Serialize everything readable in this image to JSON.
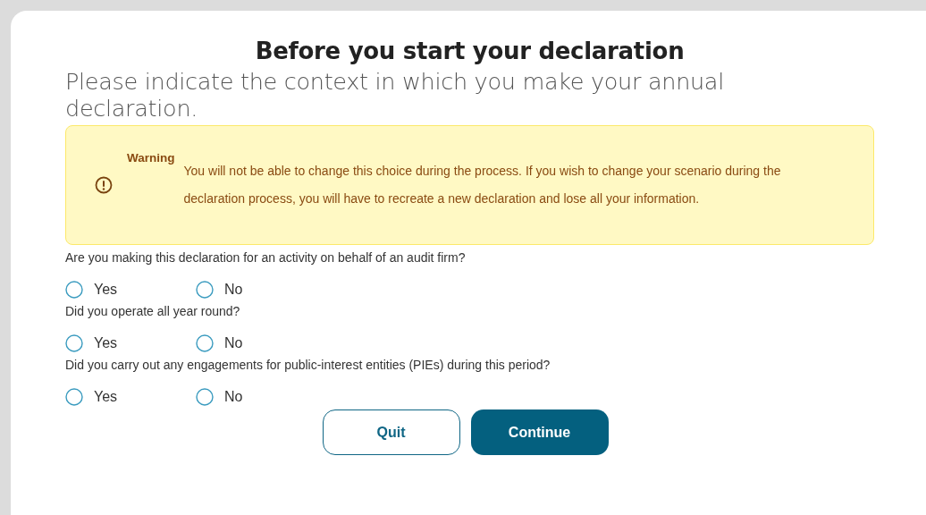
{
  "dialog": {
    "title": "Before you start your declaration",
    "subtitle": "Please indicate the context in which you make your annual declaration."
  },
  "warning": {
    "label": "Warning",
    "message": "You will not be able to change this choice during the process. If you wish to change your scenario during the declaration process, you will have to recreate a new declaration and lose all your information."
  },
  "questions": [
    {
      "text": "Are you making this declaration for an activity on behalf of an audit firm?",
      "options": [
        {
          "label": "Yes",
          "selected": false
        },
        {
          "label": "No",
          "selected": false
        }
      ]
    },
    {
      "text": "Did you operate all year round?",
      "options": [
        {
          "label": "Yes",
          "selected": false
        },
        {
          "label": "No",
          "selected": false
        }
      ]
    },
    {
      "text": "Did you carry out any engagements for public-interest entities (PIEs) during this period?",
      "options": [
        {
          "label": "Yes",
          "selected": false
        },
        {
          "label": "No",
          "selected": false
        }
      ]
    }
  ],
  "buttons": [
    {
      "label": "Quit",
      "kind": "secondary"
    },
    {
      "label": "Continue",
      "kind": "primary"
    }
  ]
}
